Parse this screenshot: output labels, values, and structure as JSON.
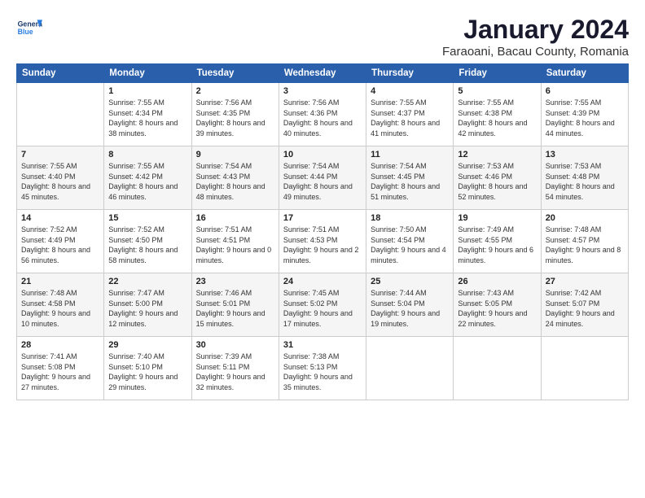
{
  "header": {
    "logo_line1": "General",
    "logo_line2": "Blue",
    "title": "January 2024",
    "subtitle": "Faraoani, Bacau County, Romania"
  },
  "columns": [
    "Sunday",
    "Monday",
    "Tuesday",
    "Wednesday",
    "Thursday",
    "Friday",
    "Saturday"
  ],
  "weeks": [
    [
      {
        "day": "",
        "sunrise": "",
        "sunset": "",
        "daylight": ""
      },
      {
        "day": "1",
        "sunrise": "Sunrise: 7:55 AM",
        "sunset": "Sunset: 4:34 PM",
        "daylight": "Daylight: 8 hours and 38 minutes."
      },
      {
        "day": "2",
        "sunrise": "Sunrise: 7:56 AM",
        "sunset": "Sunset: 4:35 PM",
        "daylight": "Daylight: 8 hours and 39 minutes."
      },
      {
        "day": "3",
        "sunrise": "Sunrise: 7:56 AM",
        "sunset": "Sunset: 4:36 PM",
        "daylight": "Daylight: 8 hours and 40 minutes."
      },
      {
        "day": "4",
        "sunrise": "Sunrise: 7:55 AM",
        "sunset": "Sunset: 4:37 PM",
        "daylight": "Daylight: 8 hours and 41 minutes."
      },
      {
        "day": "5",
        "sunrise": "Sunrise: 7:55 AM",
        "sunset": "Sunset: 4:38 PM",
        "daylight": "Daylight: 8 hours and 42 minutes."
      },
      {
        "day": "6",
        "sunrise": "Sunrise: 7:55 AM",
        "sunset": "Sunset: 4:39 PM",
        "daylight": "Daylight: 8 hours and 44 minutes."
      }
    ],
    [
      {
        "day": "7",
        "sunrise": "Sunrise: 7:55 AM",
        "sunset": "Sunset: 4:40 PM",
        "daylight": "Daylight: 8 hours and 45 minutes."
      },
      {
        "day": "8",
        "sunrise": "Sunrise: 7:55 AM",
        "sunset": "Sunset: 4:42 PM",
        "daylight": "Daylight: 8 hours and 46 minutes."
      },
      {
        "day": "9",
        "sunrise": "Sunrise: 7:54 AM",
        "sunset": "Sunset: 4:43 PM",
        "daylight": "Daylight: 8 hours and 48 minutes."
      },
      {
        "day": "10",
        "sunrise": "Sunrise: 7:54 AM",
        "sunset": "Sunset: 4:44 PM",
        "daylight": "Daylight: 8 hours and 49 minutes."
      },
      {
        "day": "11",
        "sunrise": "Sunrise: 7:54 AM",
        "sunset": "Sunset: 4:45 PM",
        "daylight": "Daylight: 8 hours and 51 minutes."
      },
      {
        "day": "12",
        "sunrise": "Sunrise: 7:53 AM",
        "sunset": "Sunset: 4:46 PM",
        "daylight": "Daylight: 8 hours and 52 minutes."
      },
      {
        "day": "13",
        "sunrise": "Sunrise: 7:53 AM",
        "sunset": "Sunset: 4:48 PM",
        "daylight": "Daylight: 8 hours and 54 minutes."
      }
    ],
    [
      {
        "day": "14",
        "sunrise": "Sunrise: 7:52 AM",
        "sunset": "Sunset: 4:49 PM",
        "daylight": "Daylight: 8 hours and 56 minutes."
      },
      {
        "day": "15",
        "sunrise": "Sunrise: 7:52 AM",
        "sunset": "Sunset: 4:50 PM",
        "daylight": "Daylight: 8 hours and 58 minutes."
      },
      {
        "day": "16",
        "sunrise": "Sunrise: 7:51 AM",
        "sunset": "Sunset: 4:51 PM",
        "daylight": "Daylight: 9 hours and 0 minutes."
      },
      {
        "day": "17",
        "sunrise": "Sunrise: 7:51 AM",
        "sunset": "Sunset: 4:53 PM",
        "daylight": "Daylight: 9 hours and 2 minutes."
      },
      {
        "day": "18",
        "sunrise": "Sunrise: 7:50 AM",
        "sunset": "Sunset: 4:54 PM",
        "daylight": "Daylight: 9 hours and 4 minutes."
      },
      {
        "day": "19",
        "sunrise": "Sunrise: 7:49 AM",
        "sunset": "Sunset: 4:55 PM",
        "daylight": "Daylight: 9 hours and 6 minutes."
      },
      {
        "day": "20",
        "sunrise": "Sunrise: 7:48 AM",
        "sunset": "Sunset: 4:57 PM",
        "daylight": "Daylight: 9 hours and 8 minutes."
      }
    ],
    [
      {
        "day": "21",
        "sunrise": "Sunrise: 7:48 AM",
        "sunset": "Sunset: 4:58 PM",
        "daylight": "Daylight: 9 hours and 10 minutes."
      },
      {
        "day": "22",
        "sunrise": "Sunrise: 7:47 AM",
        "sunset": "Sunset: 5:00 PM",
        "daylight": "Daylight: 9 hours and 12 minutes."
      },
      {
        "day": "23",
        "sunrise": "Sunrise: 7:46 AM",
        "sunset": "Sunset: 5:01 PM",
        "daylight": "Daylight: 9 hours and 15 minutes."
      },
      {
        "day": "24",
        "sunrise": "Sunrise: 7:45 AM",
        "sunset": "Sunset: 5:02 PM",
        "daylight": "Daylight: 9 hours and 17 minutes."
      },
      {
        "day": "25",
        "sunrise": "Sunrise: 7:44 AM",
        "sunset": "Sunset: 5:04 PM",
        "daylight": "Daylight: 9 hours and 19 minutes."
      },
      {
        "day": "26",
        "sunrise": "Sunrise: 7:43 AM",
        "sunset": "Sunset: 5:05 PM",
        "daylight": "Daylight: 9 hours and 22 minutes."
      },
      {
        "day": "27",
        "sunrise": "Sunrise: 7:42 AM",
        "sunset": "Sunset: 5:07 PM",
        "daylight": "Daylight: 9 hours and 24 minutes."
      }
    ],
    [
      {
        "day": "28",
        "sunrise": "Sunrise: 7:41 AM",
        "sunset": "Sunset: 5:08 PM",
        "daylight": "Daylight: 9 hours and 27 minutes."
      },
      {
        "day": "29",
        "sunrise": "Sunrise: 7:40 AM",
        "sunset": "Sunset: 5:10 PM",
        "daylight": "Daylight: 9 hours and 29 minutes."
      },
      {
        "day": "30",
        "sunrise": "Sunrise: 7:39 AM",
        "sunset": "Sunset: 5:11 PM",
        "daylight": "Daylight: 9 hours and 32 minutes."
      },
      {
        "day": "31",
        "sunrise": "Sunrise: 7:38 AM",
        "sunset": "Sunset: 5:13 PM",
        "daylight": "Daylight: 9 hours and 35 minutes."
      },
      {
        "day": "",
        "sunrise": "",
        "sunset": "",
        "daylight": ""
      },
      {
        "day": "",
        "sunrise": "",
        "sunset": "",
        "daylight": ""
      },
      {
        "day": "",
        "sunrise": "",
        "sunset": "",
        "daylight": ""
      }
    ]
  ]
}
